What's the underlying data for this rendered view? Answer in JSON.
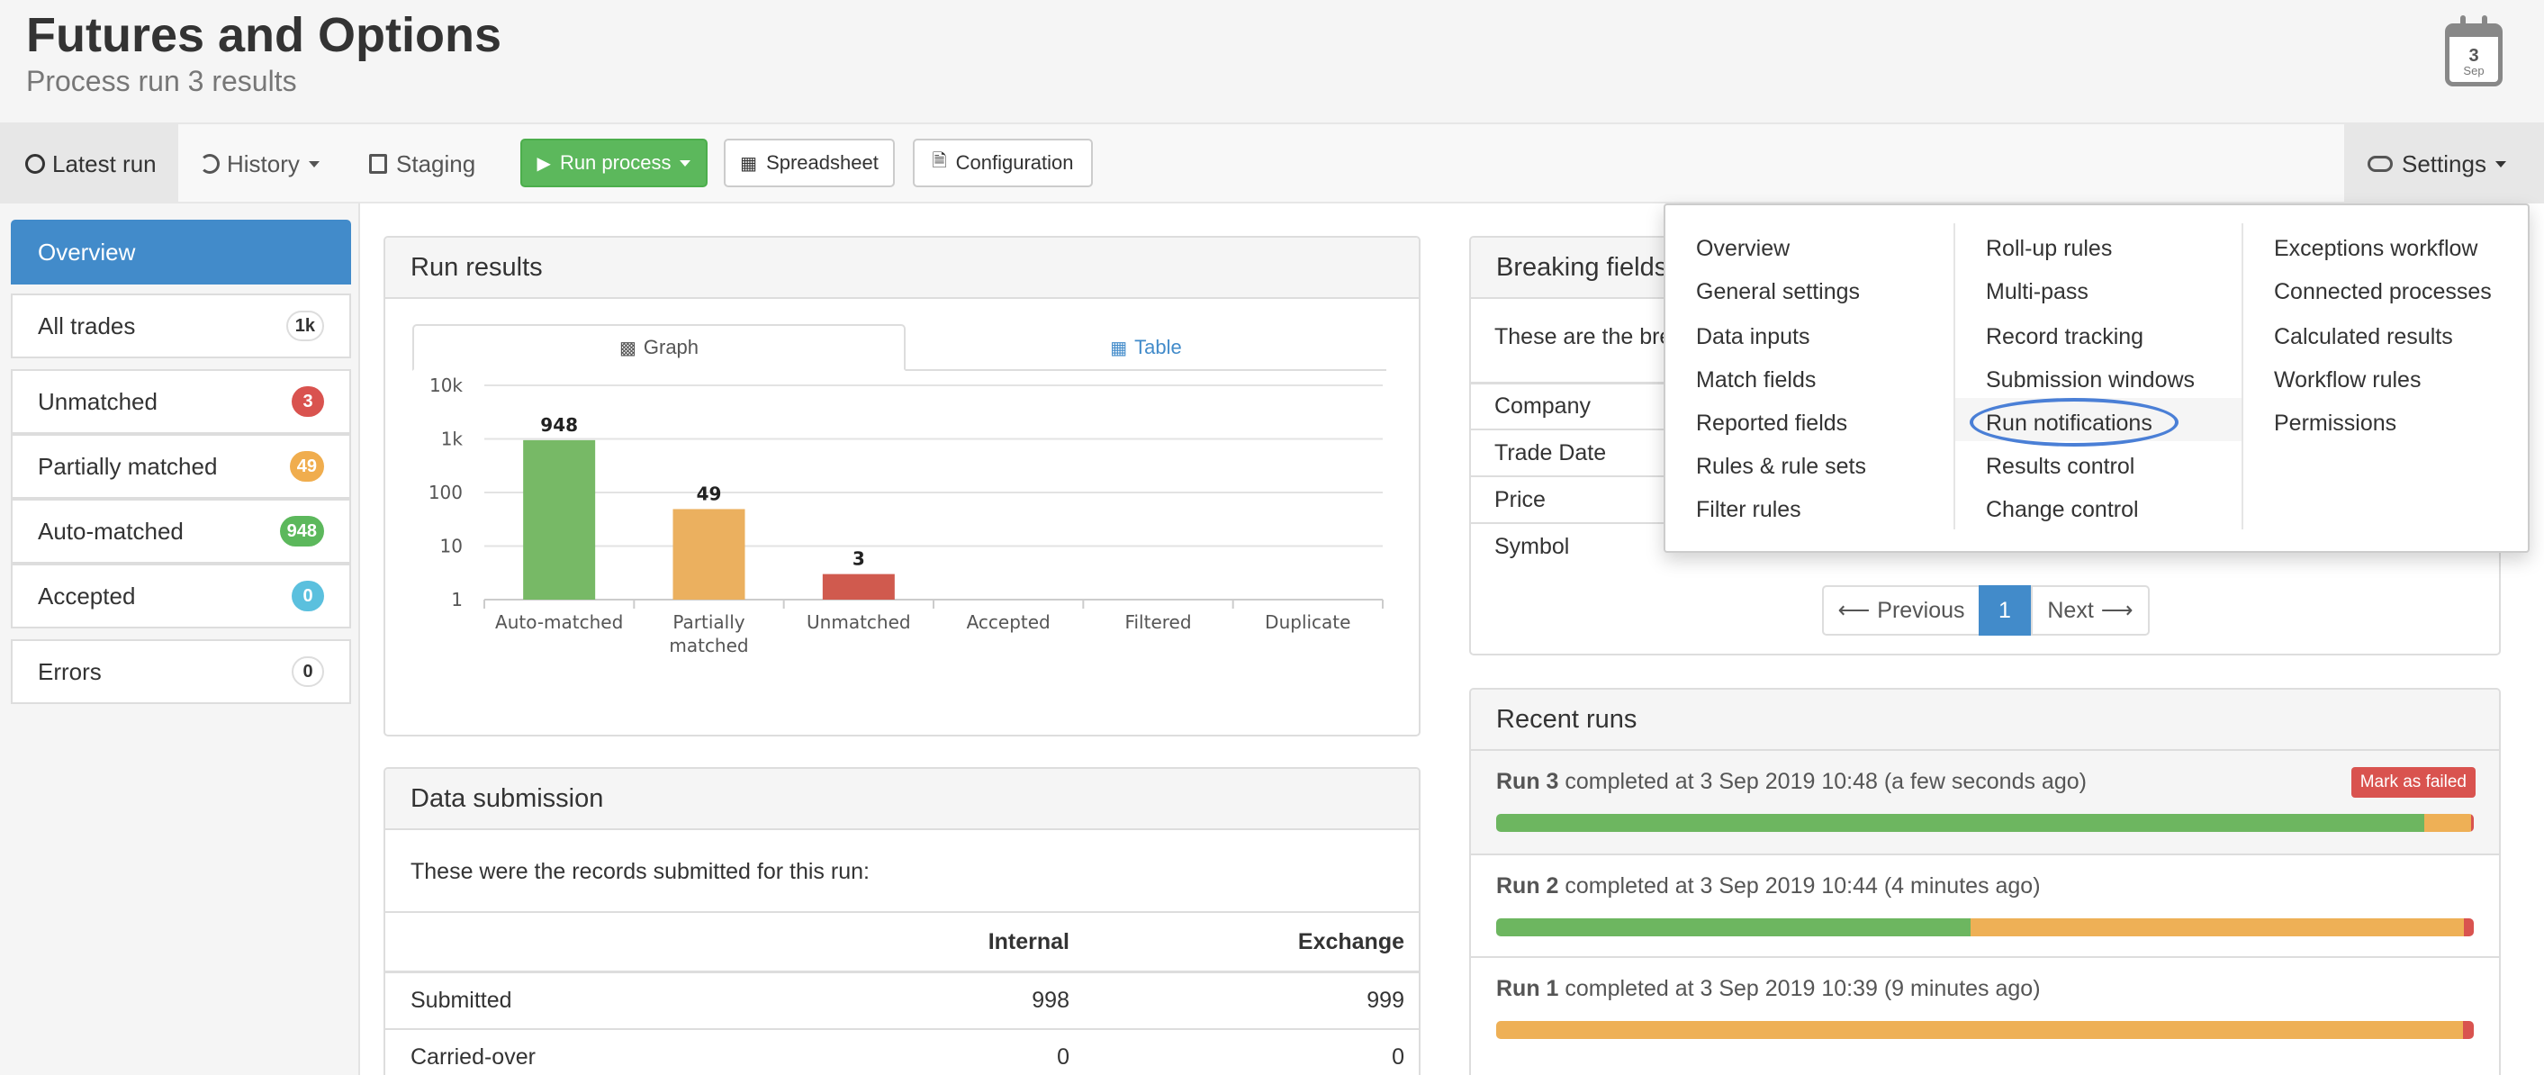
{
  "header": {
    "title": "Futures and Options",
    "subtitle": "Process run 3 results",
    "calendar": {
      "day": "3",
      "month": "Sep"
    }
  },
  "nav": {
    "latest_run": "Latest run",
    "history": "History",
    "staging": "Staging",
    "run_process": "Run process",
    "spreadsheet": "Spreadsheet",
    "configuration": "Configuration",
    "settings": "Settings"
  },
  "sidebar": {
    "items": [
      {
        "label": "Overview"
      },
      {
        "label": "All trades",
        "badge": "1k"
      },
      {
        "label": "Unmatched",
        "badge": "3",
        "color": "#d9534f"
      },
      {
        "label": "Partially matched",
        "badge": "49",
        "color": "#f0ad4e"
      },
      {
        "label": "Auto-matched",
        "badge": "948",
        "color": "#5cb85c"
      },
      {
        "label": "Accepted",
        "badge": "0",
        "color": "#5bc0de"
      },
      {
        "label": "Errors",
        "badge": "0"
      }
    ]
  },
  "run_results": {
    "title": "Run results",
    "tab_graph": "Graph",
    "tab_table": "Table"
  },
  "chart_data": {
    "type": "bar",
    "yscale": "log",
    "ylim": [
      1,
      10000
    ],
    "yticks": [
      "1",
      "10",
      "100",
      "1k",
      "10k"
    ],
    "categories": [
      "Auto-matched",
      "Partially matched",
      "Unmatched",
      "Accepted",
      "Filtered",
      "Duplicate"
    ],
    "category_lines": [
      [
        "Auto-matched"
      ],
      [
        "Partially",
        "matched"
      ],
      [
        "Unmatched"
      ],
      [
        "Accepted"
      ],
      [
        "Filtered"
      ],
      [
        "Duplicate"
      ]
    ],
    "values": [
      948,
      49,
      3,
      0,
      0,
      0
    ],
    "labels": [
      "948",
      "49",
      "3",
      "",
      "",
      ""
    ],
    "colors": [
      "#77b966",
      "#ebb05f",
      "#d05a4e",
      "#cccccc",
      "#cccccc",
      "#cccccc"
    ],
    "grid": true
  },
  "data_submission": {
    "title": "Data submission",
    "intro": "These were the records submitted for this run:",
    "col_internal": "Internal",
    "col_exchange": "Exchange",
    "rows": [
      {
        "label": "Submitted",
        "internal": "998",
        "exchange": "999"
      },
      {
        "label": "Carried-over",
        "internal": "0",
        "exchange": "0"
      }
    ]
  },
  "breaking_fields": {
    "title": "Breaking fields",
    "intro": "These are the bre",
    "fields": [
      "Company",
      "Trade Date",
      "Price",
      "Symbol"
    ]
  },
  "pagination": {
    "previous": "Previous",
    "page": "1",
    "next": "Next"
  },
  "recent_runs": {
    "title": "Recent runs",
    "mark_failed": "Mark as failed",
    "runs": [
      {
        "name": "Run 3",
        "text": "completed at 3 Sep 2019 10:48 (a few seconds ago)",
        "auto": 94.9,
        "partial": 4.8,
        "unmatched": 0.3
      },
      {
        "name": "Run 2",
        "text": "completed at 3 Sep 2019 10:44 (4 minutes ago)",
        "auto": 48.5,
        "partial": 50.5,
        "unmatched": 1.0
      },
      {
        "name": "Run 1",
        "text": "completed at 3 Sep 2019 10:39 (9 minutes ago)",
        "auto": 0,
        "partial": 98.9,
        "unmatched": 1.1
      }
    ],
    "colors": {
      "auto": "#6db660",
      "partial": "#eeb056",
      "unmatched": "#d9534f"
    }
  },
  "settings_menu": {
    "col1": [
      "Overview",
      "General settings",
      "Data inputs",
      "Match fields",
      "Reported fields",
      "Rules & rule sets",
      "Filter rules"
    ],
    "col2": [
      "Roll-up rules",
      "Multi-pass",
      "Record tracking",
      "Submission windows",
      "Run notifications",
      "Results control",
      "Change control"
    ],
    "col3": [
      "Exceptions workflow",
      "Connected processes",
      "Calculated results",
      "Workflow rules",
      "Permissions"
    ]
  }
}
